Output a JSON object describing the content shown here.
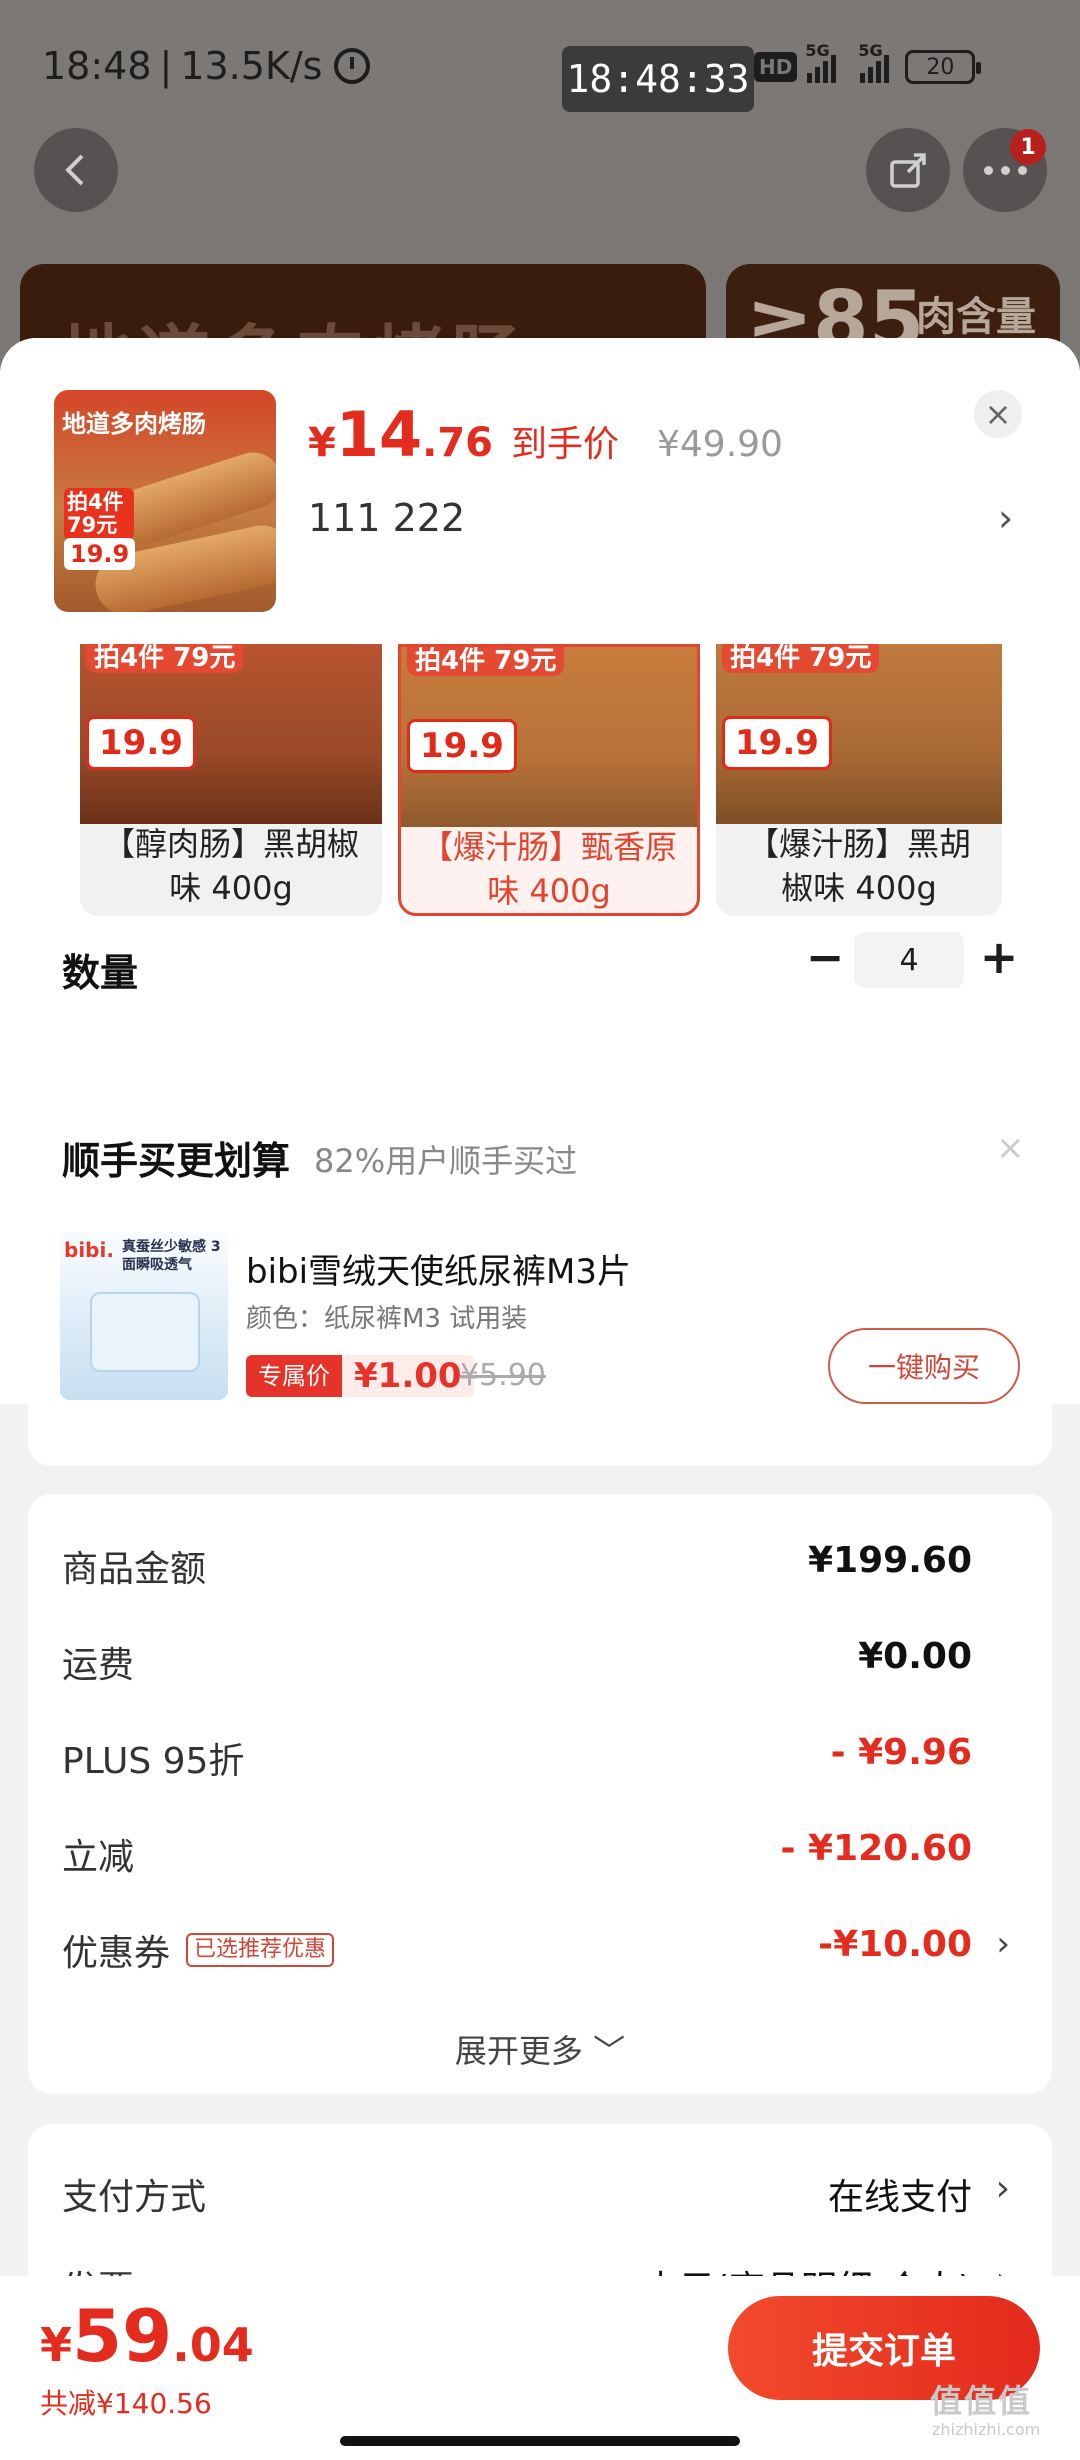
{
  "status_bar": {
    "time": "18:48",
    "speed": "13.5K/s",
    "clock": "18:48:33",
    "hd": "HD",
    "net1": "5G",
    "net2": "5G",
    "battery": "20"
  },
  "notify_count": "1",
  "background_banner": {
    "left_text": "地道多肉烤肠",
    "right_big": "≥85",
    "right_small": "肉含量"
  },
  "product": {
    "thumb_title": "地道多肉烤肠",
    "thumb_promo": "拍4件 79元",
    "thumb_price": "19.9",
    "price_yen": "¥",
    "price_int": "14",
    "price_dec": ".76",
    "price_label": "到手价",
    "original_price": "¥49.90",
    "spec": "111  222"
  },
  "variants": [
    {
      "label": "【醇肉肠】黑胡椒味 400g",
      "promo": "拍4件 79元",
      "price": "19.9",
      "selected": false
    },
    {
      "label": "【爆汁肠】甄香原味 400g",
      "promo": "拍4件 79元",
      "price": "19.9",
      "selected": true
    },
    {
      "label": "【爆汁肠】黑胡椒味 400g",
      "promo": "拍4件 79元",
      "price": "19.9",
      "selected": false
    }
  ],
  "quantity": {
    "label": "数量",
    "value": "4",
    "minus": "−",
    "plus": "+"
  },
  "addon": {
    "title": "顺手买更划算",
    "subtitle": "82%用户顺手买过",
    "thumb_brand": "bibi.",
    "thumb_copy": "真蚕丝少敏感 3面瞬吸透气",
    "name": "bibi雪绒天使纸尿裤M3片",
    "spec": "颜色：纸尿裤M3 试用装",
    "tag_label": "专属价",
    "price": "¥1.00",
    "original": "¥5.90",
    "buy_button": "一键购买"
  },
  "summary": {
    "rows": [
      {
        "label": "商品金额",
        "value": "¥199.60",
        "red": false
      },
      {
        "label": "运费",
        "value": "¥0.00",
        "red": false
      },
      {
        "label": "PLUS 95折",
        "value": "- ¥9.96",
        "red": true
      },
      {
        "label": "立减",
        "value": "- ¥120.60",
        "red": true
      },
      {
        "label": "优惠券",
        "tag": "已选推荐优惠",
        "value": "-¥10.00",
        "red": true,
        "arrow": "›"
      }
    ],
    "expand": "展开更多 ﹀"
  },
  "payment": {
    "rows": [
      {
        "label": "支付方式",
        "value": "在线支付",
        "arrow": "›"
      },
      {
        "label": "发票",
        "value": "电子(商品明细-个人)",
        "arrow": "›"
      }
    ]
  },
  "bottom": {
    "total_yen": "¥",
    "total_int": "59",
    "total_dec": ".04",
    "saved": "共减¥140.56",
    "submit": "提交订单"
  },
  "watermark": {
    "main": "值值值",
    "sub": "zhizhizhi.com"
  },
  "colors": {
    "accent": "#e42c1e",
    "sheet_bg": "#f2f2f2",
    "dim_overlay": "#7a7775"
  }
}
